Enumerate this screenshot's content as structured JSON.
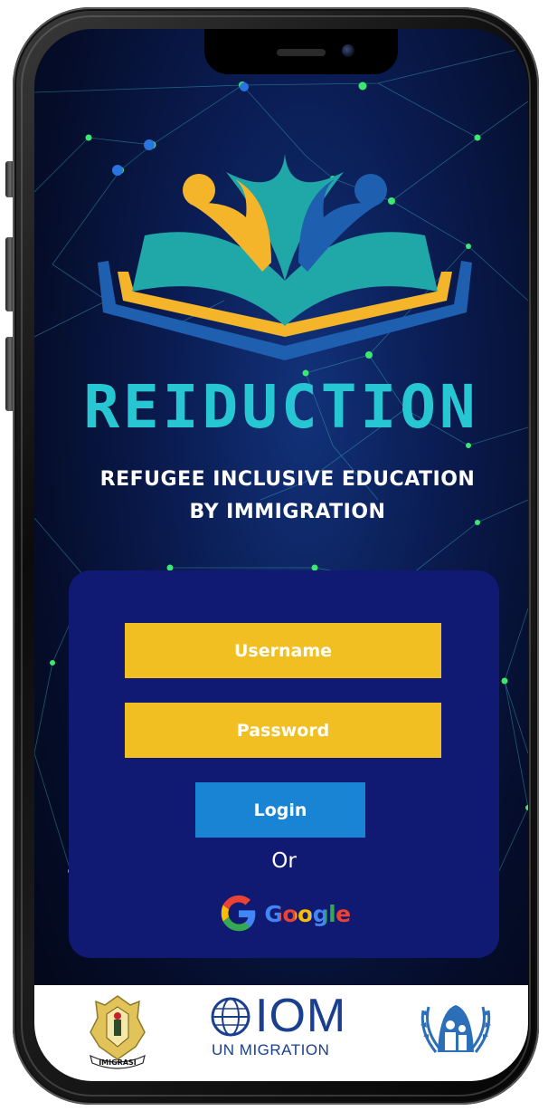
{
  "app": {
    "title": "REIDUCTION",
    "subtitle_line1": "REFUGEE INCLUSIVE EDUCATION",
    "subtitle_line2": "BY IMMIGRATION"
  },
  "login_form": {
    "username_placeholder": "Username",
    "password_placeholder": "Password",
    "login_label": "Login",
    "or_label": "Or",
    "google_label": "Google"
  },
  "partners": {
    "iom_word": "IOM",
    "iom_subtitle": "UN MIGRATION",
    "immigration_logo": "IMIGRASI"
  },
  "colors": {
    "title_accent": "#26c6d3",
    "field_background": "#f2bf22",
    "card_background": "#101a72",
    "login_button": "#1a84d4",
    "iom_blue": "#1a3f8f",
    "unhcr_blue": "#2c6fb8"
  },
  "icons": {
    "logo": "open-book-people-icon",
    "google": "google-g-icon",
    "immigration": "immigration-emblem-icon",
    "iom": "iom-globe-icon",
    "unhcr": "unhcr-emblem-icon"
  }
}
